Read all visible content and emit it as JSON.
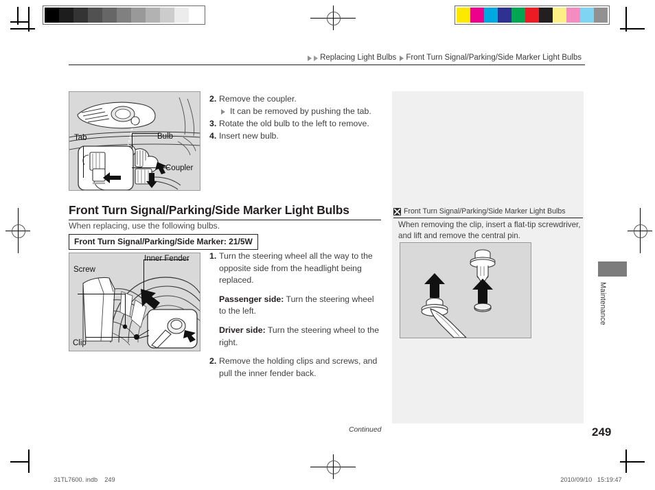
{
  "document": {
    "page_number": "249",
    "continued_label": "Continued",
    "thumb_tab_label": "Maintenance",
    "print_file": "31TL7600. indb",
    "print_page": "249",
    "print_date": "2010/09/10",
    "print_time": "15:19:47"
  },
  "breadcrumb": {
    "crumbs": [
      "Replacing Light Bulbs",
      "Front Turn Signal/Parking/Side Marker Light Bulbs"
    ]
  },
  "figure_top": {
    "labels": {
      "tab": "Tab",
      "bulb": "Bulb",
      "coupler": "Coupler"
    }
  },
  "figure_fender": {
    "labels": {
      "inner_fender": "Inner Fender",
      "screw": "Screw",
      "clip": "Clip"
    }
  },
  "steps_top": [
    {
      "num": "2.",
      "text": "Remove the coupler.",
      "sub": "It can be removed by pushing the tab."
    },
    {
      "num": "3.",
      "text": "Rotate the old bulb to the left to remove.",
      "sub": ""
    },
    {
      "num": "4.",
      "text": "Insert new bulb.",
      "sub": ""
    }
  ],
  "section": {
    "heading": "Front Turn Signal/Parking/Side Marker Light Bulbs",
    "intro": "When replacing, use the following bulbs.",
    "spec_label": "Front Turn Signal/Parking/Side Marker: 21/5W"
  },
  "steps_bottom": {
    "step1_num": "1.",
    "step1_text": "Turn the steering wheel all the way to the opposite side from the headlight being replaced.",
    "passenger_label": "Passenger side:",
    "passenger_text": " Turn the steering wheel to the left.",
    "driver_label": "Driver side:",
    "driver_text": " Turn the steering wheel to the right.",
    "step2_num": "2.",
    "step2_text": "Remove the holding clips and screws, and pull the inner fender back."
  },
  "side_note": {
    "title": "Front Turn Signal/Parking/Side Marker Light Bulbs",
    "body": "When removing the clip, insert a flat-tip screwdriver, and lift and remove the central pin."
  },
  "gray_bar": {
    "swatches": [
      "#000000",
      "#1d1d1d",
      "#343434",
      "#515151",
      "#666666",
      "#808080",
      "#999999",
      "#b2b2b2",
      "#cccccc",
      "#ececec",
      "#ffffff"
    ]
  },
  "color_bar": {
    "swatches": [
      "#ffe800",
      "#ec008c",
      "#00a8e1",
      "#2e3192",
      "#00a651",
      "#ed1c24",
      "#231f20",
      "#fdef86",
      "#f48cc0",
      "#7fd4f4",
      "#919191"
    ]
  }
}
